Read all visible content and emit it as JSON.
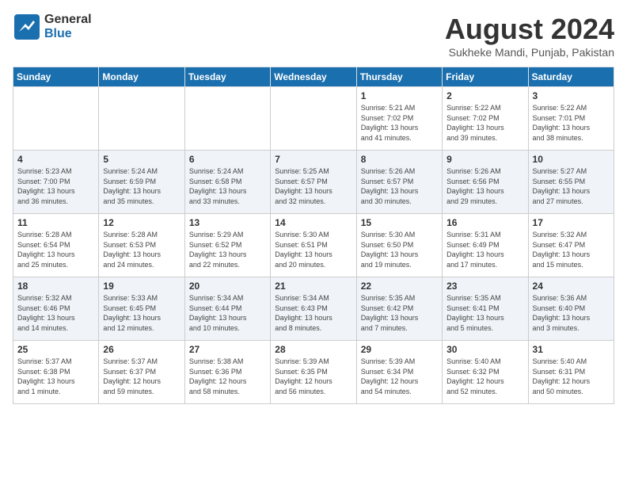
{
  "header": {
    "logo_general": "General",
    "logo_blue": "Blue",
    "month_title": "August 2024",
    "location": "Sukheke Mandi, Punjab, Pakistan"
  },
  "weekdays": [
    "Sunday",
    "Monday",
    "Tuesday",
    "Wednesday",
    "Thursday",
    "Friday",
    "Saturday"
  ],
  "weeks": [
    [
      {
        "day": "",
        "info": ""
      },
      {
        "day": "",
        "info": ""
      },
      {
        "day": "",
        "info": ""
      },
      {
        "day": "",
        "info": ""
      },
      {
        "day": "1",
        "info": "Sunrise: 5:21 AM\nSunset: 7:02 PM\nDaylight: 13 hours\nand 41 minutes."
      },
      {
        "day": "2",
        "info": "Sunrise: 5:22 AM\nSunset: 7:02 PM\nDaylight: 13 hours\nand 39 minutes."
      },
      {
        "day": "3",
        "info": "Sunrise: 5:22 AM\nSunset: 7:01 PM\nDaylight: 13 hours\nand 38 minutes."
      }
    ],
    [
      {
        "day": "4",
        "info": "Sunrise: 5:23 AM\nSunset: 7:00 PM\nDaylight: 13 hours\nand 36 minutes."
      },
      {
        "day": "5",
        "info": "Sunrise: 5:24 AM\nSunset: 6:59 PM\nDaylight: 13 hours\nand 35 minutes."
      },
      {
        "day": "6",
        "info": "Sunrise: 5:24 AM\nSunset: 6:58 PM\nDaylight: 13 hours\nand 33 minutes."
      },
      {
        "day": "7",
        "info": "Sunrise: 5:25 AM\nSunset: 6:57 PM\nDaylight: 13 hours\nand 32 minutes."
      },
      {
        "day": "8",
        "info": "Sunrise: 5:26 AM\nSunset: 6:57 PM\nDaylight: 13 hours\nand 30 minutes."
      },
      {
        "day": "9",
        "info": "Sunrise: 5:26 AM\nSunset: 6:56 PM\nDaylight: 13 hours\nand 29 minutes."
      },
      {
        "day": "10",
        "info": "Sunrise: 5:27 AM\nSunset: 6:55 PM\nDaylight: 13 hours\nand 27 minutes."
      }
    ],
    [
      {
        "day": "11",
        "info": "Sunrise: 5:28 AM\nSunset: 6:54 PM\nDaylight: 13 hours\nand 25 minutes."
      },
      {
        "day": "12",
        "info": "Sunrise: 5:28 AM\nSunset: 6:53 PM\nDaylight: 13 hours\nand 24 minutes."
      },
      {
        "day": "13",
        "info": "Sunrise: 5:29 AM\nSunset: 6:52 PM\nDaylight: 13 hours\nand 22 minutes."
      },
      {
        "day": "14",
        "info": "Sunrise: 5:30 AM\nSunset: 6:51 PM\nDaylight: 13 hours\nand 20 minutes."
      },
      {
        "day": "15",
        "info": "Sunrise: 5:30 AM\nSunset: 6:50 PM\nDaylight: 13 hours\nand 19 minutes."
      },
      {
        "day": "16",
        "info": "Sunrise: 5:31 AM\nSunset: 6:49 PM\nDaylight: 13 hours\nand 17 minutes."
      },
      {
        "day": "17",
        "info": "Sunrise: 5:32 AM\nSunset: 6:47 PM\nDaylight: 13 hours\nand 15 minutes."
      }
    ],
    [
      {
        "day": "18",
        "info": "Sunrise: 5:32 AM\nSunset: 6:46 PM\nDaylight: 13 hours\nand 14 minutes."
      },
      {
        "day": "19",
        "info": "Sunrise: 5:33 AM\nSunset: 6:45 PM\nDaylight: 13 hours\nand 12 minutes."
      },
      {
        "day": "20",
        "info": "Sunrise: 5:34 AM\nSunset: 6:44 PM\nDaylight: 13 hours\nand 10 minutes."
      },
      {
        "day": "21",
        "info": "Sunrise: 5:34 AM\nSunset: 6:43 PM\nDaylight: 13 hours\nand 8 minutes."
      },
      {
        "day": "22",
        "info": "Sunrise: 5:35 AM\nSunset: 6:42 PM\nDaylight: 13 hours\nand 7 minutes."
      },
      {
        "day": "23",
        "info": "Sunrise: 5:35 AM\nSunset: 6:41 PM\nDaylight: 13 hours\nand 5 minutes."
      },
      {
        "day": "24",
        "info": "Sunrise: 5:36 AM\nSunset: 6:40 PM\nDaylight: 13 hours\nand 3 minutes."
      }
    ],
    [
      {
        "day": "25",
        "info": "Sunrise: 5:37 AM\nSunset: 6:38 PM\nDaylight: 13 hours\nand 1 minute."
      },
      {
        "day": "26",
        "info": "Sunrise: 5:37 AM\nSunset: 6:37 PM\nDaylight: 12 hours\nand 59 minutes."
      },
      {
        "day": "27",
        "info": "Sunrise: 5:38 AM\nSunset: 6:36 PM\nDaylight: 12 hours\nand 58 minutes."
      },
      {
        "day": "28",
        "info": "Sunrise: 5:39 AM\nSunset: 6:35 PM\nDaylight: 12 hours\nand 56 minutes."
      },
      {
        "day": "29",
        "info": "Sunrise: 5:39 AM\nSunset: 6:34 PM\nDaylight: 12 hours\nand 54 minutes."
      },
      {
        "day": "30",
        "info": "Sunrise: 5:40 AM\nSunset: 6:32 PM\nDaylight: 12 hours\nand 52 minutes."
      },
      {
        "day": "31",
        "info": "Sunrise: 5:40 AM\nSunset: 6:31 PM\nDaylight: 12 hours\nand 50 minutes."
      }
    ]
  ]
}
